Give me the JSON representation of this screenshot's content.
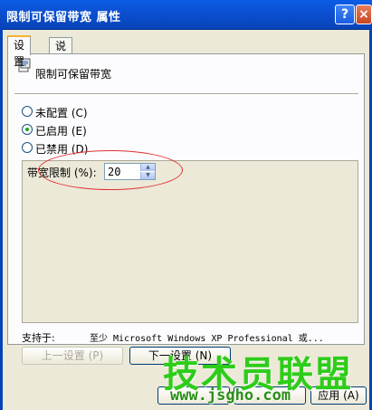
{
  "window": {
    "title": "限制可保留带宽 属性",
    "help_label": "?",
    "close_label": "×"
  },
  "tabs": [
    {
      "label": "设置"
    },
    {
      "label": "说明"
    }
  ],
  "policy": {
    "name": "限制可保留带宽"
  },
  "radios": [
    {
      "label": "未配置 (C)",
      "checked": false
    },
    {
      "label": "已启用 (E)",
      "checked": true
    },
    {
      "label": "已禁用 (D)",
      "checked": false
    }
  ],
  "bandwidth": {
    "label": "带宽限制 (%):",
    "value": "20"
  },
  "supported": {
    "label": "支持于:",
    "text": "至少 Microsoft Windows XP Professional 或..."
  },
  "buttons": {
    "prev": "上一设置 (P)",
    "next": "下一设置 (N)",
    "apply": "应用 (A)"
  },
  "watermark": {
    "title": "技术员联盟",
    "url": "www.jsgho.com"
  }
}
